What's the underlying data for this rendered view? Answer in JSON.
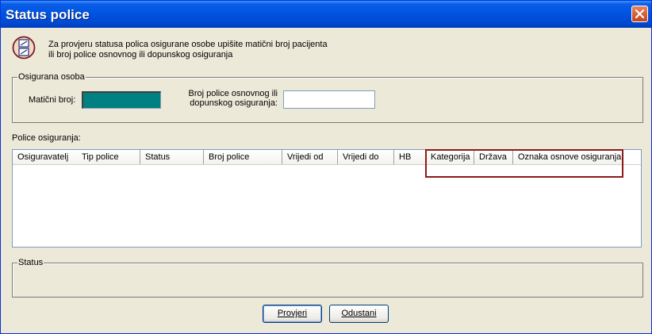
{
  "window": {
    "title": "Status police"
  },
  "info": {
    "line1": "Za provjeru statusa polica osigurane osobe upišite matični broj pacijenta",
    "line2": "ili broj police osnovnog ili dopunskog osiguranja"
  },
  "osoba": {
    "legend": "Osigurana osoba",
    "maticni_label": "Matični broj:",
    "maticni_value": "",
    "polica_label_1": "Broj police osnovnog ili",
    "polica_label_2": "dopunskog osiguranja:",
    "polica_value": ""
  },
  "police": {
    "label": "Police osiguranja:",
    "columns": [
      "Osiguravatelj",
      "Tip police",
      "Status",
      "Broj police",
      "Vrijedi od",
      "Vrijedi do",
      "HB",
      "Kategorija",
      "Država",
      "Oznaka osnove osiguranja"
    ],
    "rows": []
  },
  "status": {
    "legend": "Status"
  },
  "buttons": {
    "provjeri": "Provjeri",
    "odustani": "Odustani"
  },
  "colors": {
    "title_bar": "#0052e0",
    "highlight": "#8b1a1a",
    "maticni_field": "#008080"
  }
}
